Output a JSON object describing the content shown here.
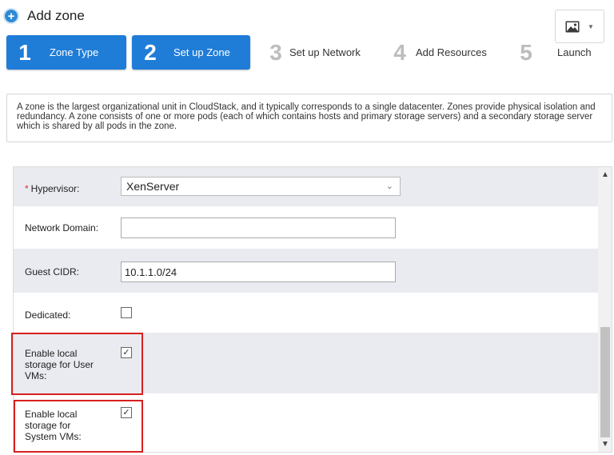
{
  "header": {
    "title": "Add zone",
    "icon": "plus-circle-icon",
    "image_button_icon": "image-icon"
  },
  "steps": [
    {
      "number": "1",
      "label": "Zone Type",
      "active": true
    },
    {
      "number": "2",
      "label": "Set up Zone",
      "active": true
    },
    {
      "number": "3",
      "label": "Set up Network",
      "active": false
    },
    {
      "number": "4",
      "label": "Add Resources",
      "active": false
    },
    {
      "number": "5",
      "label": "Launch",
      "active": false
    }
  ],
  "description": "A zone is the largest organizational unit in CloudStack, and it typically corresponds to a single datacenter. Zones provide physical isolation and redundancy. A zone consists of one or more pods (each of which contains hosts and primary storage servers) and a secondary storage server which is shared by all pods in the zone.",
  "form": {
    "hypervisor": {
      "label": "Hypervisor:",
      "required": "*",
      "value": "XenServer"
    },
    "network_domain": {
      "label": "Network Domain:",
      "value": ""
    },
    "guest_cidr": {
      "label": "Guest CIDR:",
      "value": "10.1.1.0/24"
    },
    "dedicated": {
      "label": "Dedicated:",
      "checked": false
    },
    "local_storage_user": {
      "label_lines": [
        "Enable local",
        "storage for User",
        "VMs:"
      ],
      "checked": true
    },
    "local_storage_system": {
      "label_lines": [
        "Enable local",
        "storage for",
        "System VMs:"
      ],
      "checked": true
    }
  },
  "colors": {
    "step_active": "#1f7dd8",
    "highlight": "#d61f1f",
    "row_shaded": "#e9ebf1"
  }
}
